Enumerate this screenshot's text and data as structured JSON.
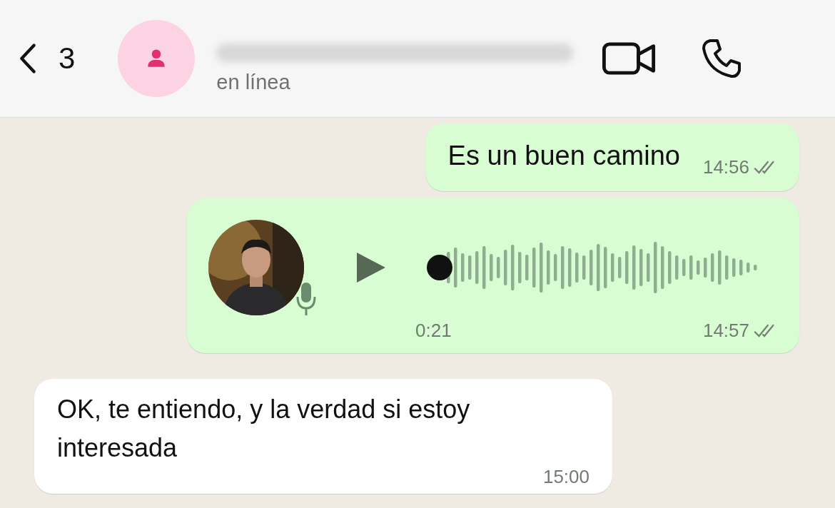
{
  "header": {
    "back_count": "3",
    "status": "en línea"
  },
  "messages": [
    {
      "kind": "text",
      "outgoing": true,
      "text": "Es un buen camino",
      "time": "14:56",
      "read": false
    },
    {
      "kind": "voice",
      "outgoing": true,
      "duration": "0:21",
      "level": 0,
      "time": "14:57",
      "read": false
    },
    {
      "kind": "text",
      "outgoing": false,
      "text": "OK, te entiendo, y la verdad si estoy interesada",
      "time": "15:00"
    }
  ]
}
